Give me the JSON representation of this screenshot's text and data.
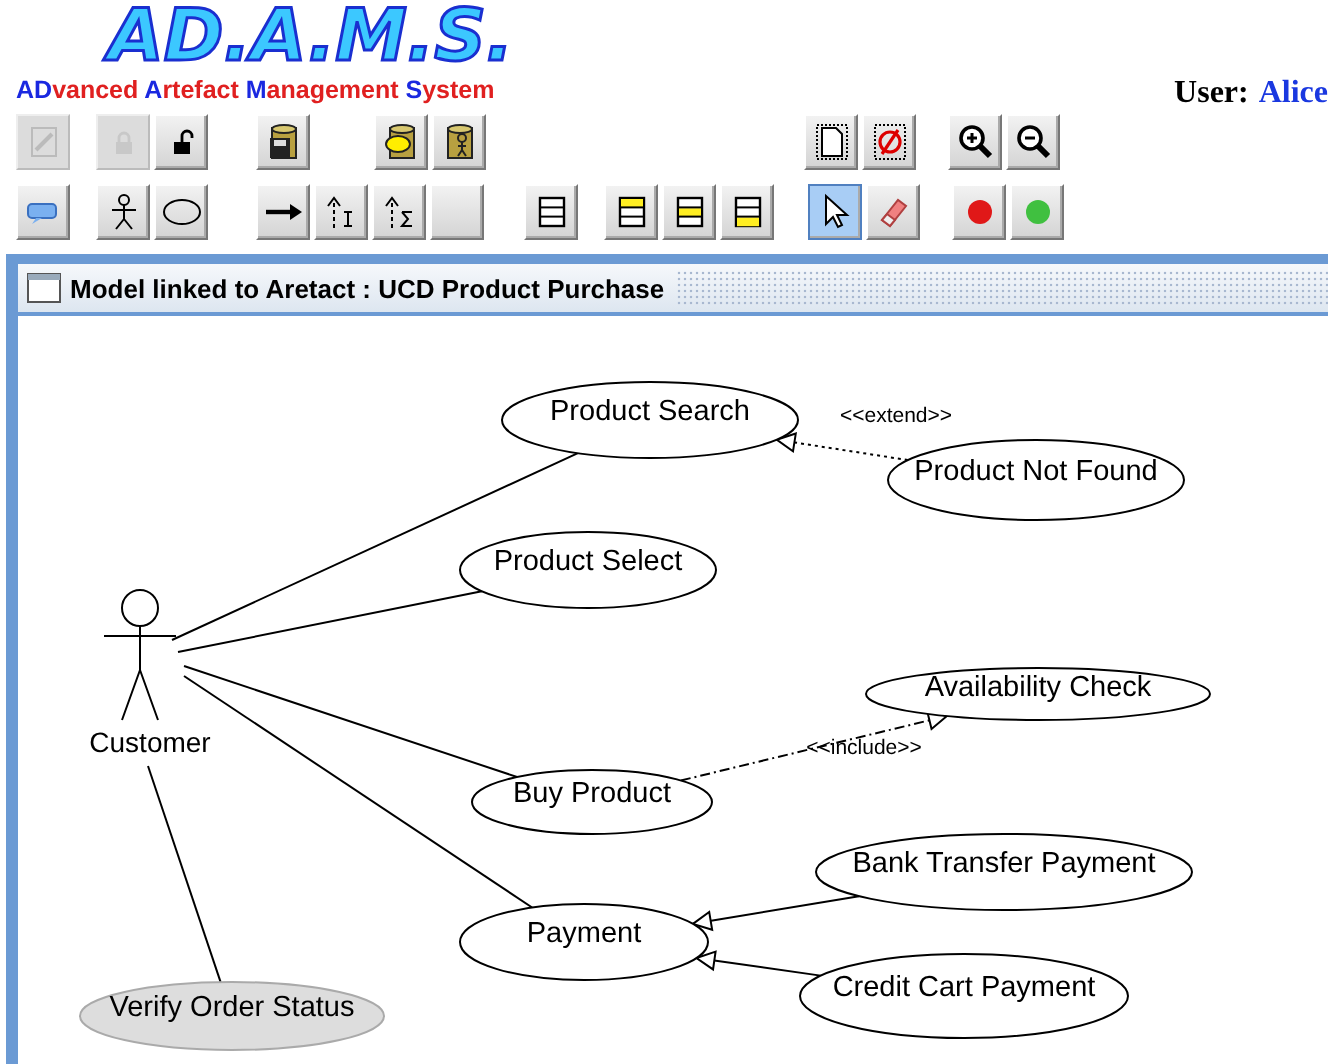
{
  "header": {
    "logo": "AD.A.M.S.",
    "subtitle": [
      {
        "text": "AD",
        "accent": true
      },
      {
        "text": "vanced ",
        "accent": false
      },
      {
        "text": "A",
        "accent": true
      },
      {
        "text": "rtefact ",
        "accent": false
      },
      {
        "text": "M",
        "accent": true
      },
      {
        "text": "anagement ",
        "accent": false
      },
      {
        "text": "S",
        "accent": true
      },
      {
        "text": "ystem",
        "accent": false
      }
    ],
    "user_label": "User:",
    "user_name": "Alice"
  },
  "toolbars": [
    {
      "groups": [
        [
          {
            "kind": "edit",
            "disabled": true,
            "selected": false
          }
        ],
        [
          {
            "kind": "lock",
            "disabled": true,
            "selected": false
          },
          {
            "kind": "unlock",
            "disabled": false,
            "selected": false
          }
        ],
        [
          {
            "kind": "save",
            "disabled": false,
            "selected": false
          }
        ],
        [
          {
            "kind": "database",
            "disabled": false,
            "selected": false
          },
          {
            "kind": "database-user",
            "disabled": false,
            "selected": false
          }
        ],
        [
          {
            "kind": "new-document",
            "disabled": false,
            "selected": false
          },
          {
            "kind": "no-document",
            "disabled": false,
            "selected": false
          }
        ],
        [
          {
            "kind": "zoom-in",
            "disabled": false,
            "selected": false
          },
          {
            "kind": "zoom-out",
            "disabled": false,
            "selected": false
          }
        ]
      ]
    },
    {
      "groups": [
        [
          {
            "kind": "comment",
            "disabled": false,
            "selected": false
          }
        ],
        [
          {
            "kind": "actor",
            "disabled": false,
            "selected": false
          },
          {
            "kind": "use-case",
            "disabled": false,
            "selected": false
          }
        ],
        [
          {
            "kind": "arrow",
            "disabled": false,
            "selected": false
          },
          {
            "kind": "include",
            "disabled": false,
            "selected": false
          },
          {
            "kind": "extend",
            "disabled": false,
            "selected": false
          },
          {
            "kind": "blank",
            "disabled": false,
            "selected": false
          }
        ],
        [
          {
            "kind": "list",
            "disabled": false,
            "selected": false
          }
        ],
        [
          {
            "kind": "list-top",
            "disabled": false,
            "selected": false
          },
          {
            "kind": "list-middle",
            "disabled": false,
            "selected": false
          },
          {
            "kind": "list-bottom",
            "disabled": false,
            "selected": false
          }
        ],
        [
          {
            "kind": "pointer",
            "disabled": false,
            "selected": true
          },
          {
            "kind": "eraser",
            "disabled": false,
            "selected": false
          }
        ],
        [
          {
            "kind": "red-dot",
            "disabled": false,
            "selected": false
          },
          {
            "kind": "green-dot",
            "disabled": false,
            "selected": false
          }
        ]
      ]
    }
  ],
  "panel": {
    "title": "Model linked to Aretact :  UCD Product Purchase",
    "diagram": {
      "actors": [
        {
          "name": "Customer"
        }
      ],
      "use_cases": [
        {
          "label": "Product Search",
          "highlighted": false
        },
        {
          "label": "Product Not Found",
          "highlighted": false
        },
        {
          "label": "Product Select",
          "highlighted": false
        },
        {
          "label": "Availability Check",
          "highlighted": false
        },
        {
          "label": "Buy Product",
          "highlighted": false
        },
        {
          "label": "Bank Transfer Payment",
          "highlighted": false
        },
        {
          "label": "Payment",
          "highlighted": false
        },
        {
          "label": "Credit Cart Payment",
          "highlighted": false
        },
        {
          "label": "Verify Order Status",
          "highlighted": true
        }
      ],
      "relations": [
        {
          "kind": "association"
        },
        {
          "kind": "association"
        },
        {
          "kind": "association"
        },
        {
          "kind": "association"
        },
        {
          "kind": "association"
        },
        {
          "kind": "extend",
          "label": "<<extend>>"
        },
        {
          "kind": "include",
          "label": "<<include>>"
        },
        {
          "kind": "generalization"
        },
        {
          "kind": "generalization"
        }
      ]
    }
  }
}
